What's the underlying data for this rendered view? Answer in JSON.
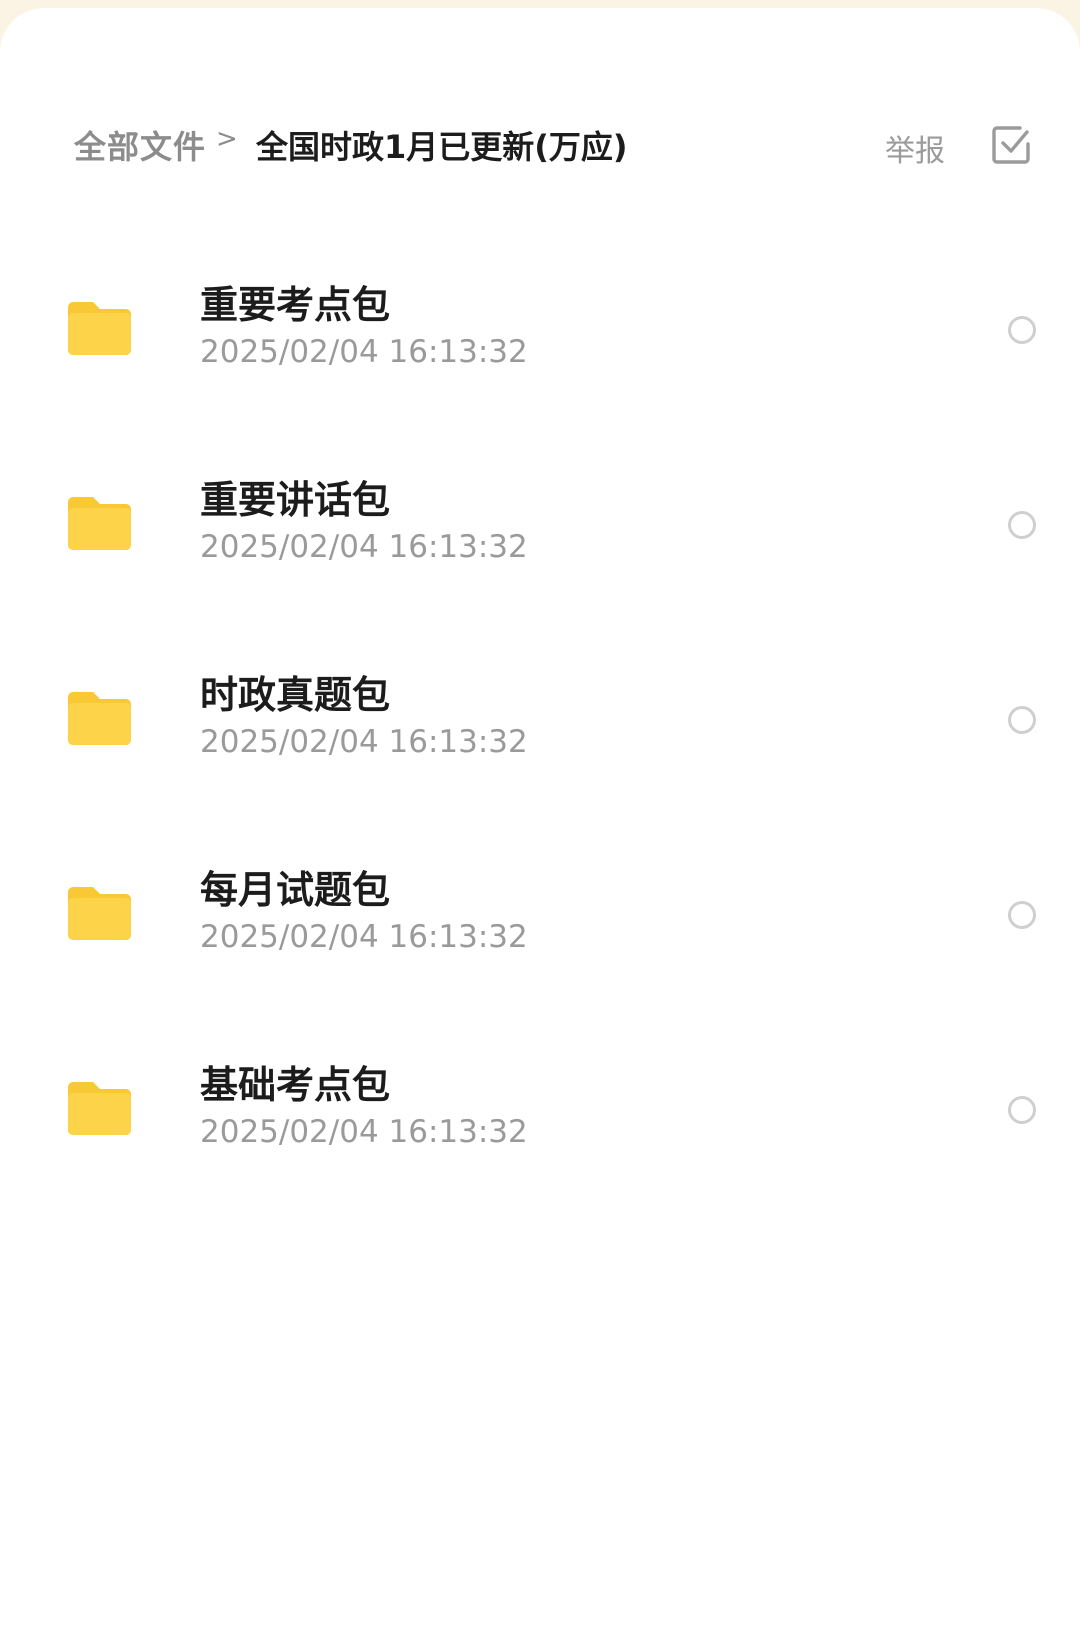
{
  "breadcrumb": {
    "root": "全部文件",
    "separator": ">",
    "current": "全国时政1月已更新(万应)"
  },
  "header": {
    "report_label": "举报",
    "select_icon": "checkbox-icon"
  },
  "files": [
    {
      "name": "重要考点包",
      "time": "2025/02/04 16:13:32",
      "icon": "folder-icon"
    },
    {
      "name": "重要讲话包",
      "time": "2025/02/04 16:13:32",
      "icon": "folder-icon"
    },
    {
      "name": "时政真题包",
      "time": "2025/02/04 16:13:32",
      "icon": "folder-icon"
    },
    {
      "name": "每月试题包",
      "time": "2025/02/04 16:13:32",
      "icon": "folder-icon"
    },
    {
      "name": "基础考点包",
      "time": "2025/02/04 16:13:32",
      "icon": "folder-icon"
    }
  ],
  "colors": {
    "folder": "#FDD34A",
    "folder_tab": "#F9C935",
    "background_top": "#FBF3E4"
  }
}
